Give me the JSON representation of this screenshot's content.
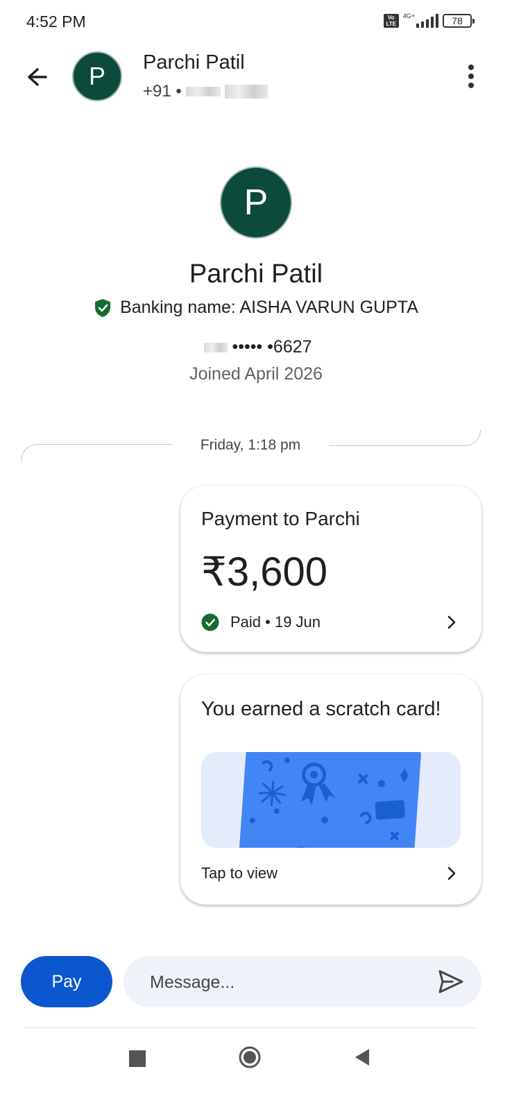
{
  "status_bar": {
    "time": "4:52 PM",
    "volte": "Vo LTE",
    "network": "4G+",
    "battery": "78"
  },
  "header": {
    "avatar_letter": "P",
    "name": "Parchi Patil",
    "phone_prefix": "+91 •"
  },
  "profile": {
    "avatar_letter": "P",
    "name": "Parchi Patil",
    "banking_name": "Banking name: AISHA VARUN GUPTA",
    "phone_masked": "••••• •6627",
    "joined": "Joined April 2026"
  },
  "chat": {
    "date_separator": "Friday, 1:18 pm",
    "payment_card": {
      "title": "Payment to Parchi",
      "amount": "₹3,600",
      "status": "Paid • 19 Jun"
    },
    "scratch_card": {
      "title": "You earned a scratch card!",
      "cta": "Tap to view"
    }
  },
  "composer": {
    "pay_label": "Pay",
    "message_placeholder": "Message..."
  },
  "colors": {
    "brand_blue": "#0b57d0",
    "avatar_green": "#0c4a3c",
    "verified_green": "#146c2e",
    "scratch_blue": "#4285f4"
  }
}
